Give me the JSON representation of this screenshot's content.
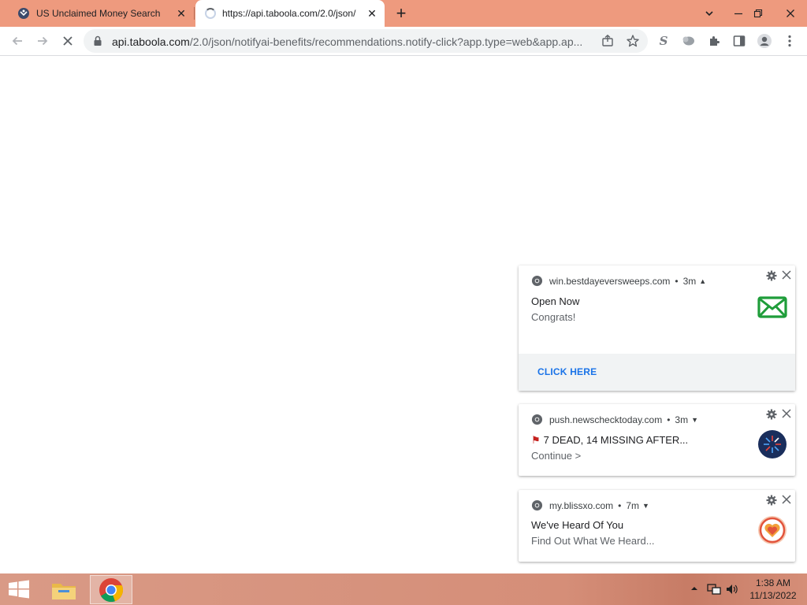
{
  "browser": {
    "tabs": [
      {
        "title": "US Unclaimed Money Search",
        "active": false
      },
      {
        "title": "https://api.taboola.com/2.0/json/",
        "active": true,
        "loading": true
      }
    ],
    "address_bar": {
      "host": "api.taboola.com",
      "path": "/2.0/json/notifyai-benefits/recommendations.notify-click?app.type=web&app.ap..."
    },
    "accent_color": "#ee9a7e"
  },
  "notifications": [
    {
      "source": "win.bestdayeversweeps.com",
      "age": "3m",
      "title": "Open Now",
      "body": "Congrats!",
      "action": "CLICK HERE",
      "icon": "envelope-icon",
      "expanded": true
    },
    {
      "source": "push.newschecktoday.com",
      "age": "3m",
      "title": "7 DEAD, 14 MISSING AFTER...",
      "body": "Continue >",
      "icon": "news-logo-icon",
      "expanded": false
    },
    {
      "source": "my.blissxo.com",
      "age": "7m",
      "title": "We've Heard Of You",
      "body": "Find Out What We Heard...",
      "icon": "heart-badge-icon",
      "expanded": false
    }
  ],
  "taskbar": {
    "time": "1:38 AM",
    "date": "11/13/2022",
    "separator_dot": "•"
  }
}
